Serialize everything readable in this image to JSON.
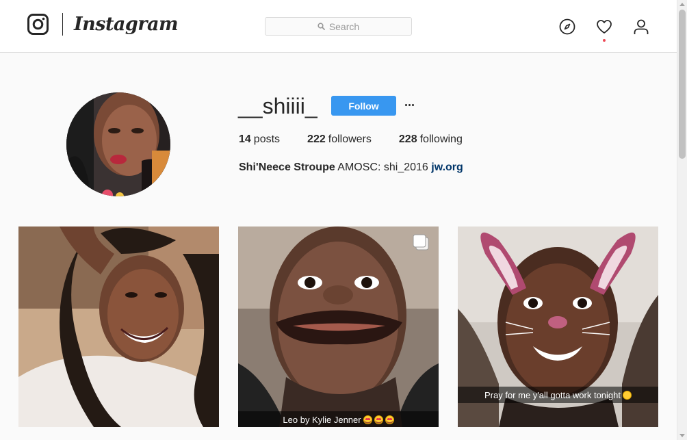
{
  "header": {
    "wordmark": "Instagram",
    "search_placeholder": "Search",
    "nav_icons": [
      "explore-compass-icon",
      "activity-heart-icon",
      "profile-person-icon"
    ],
    "has_activity_notification": true
  },
  "profile": {
    "username": "__shiiii_",
    "follow_label": "Follow",
    "stats": [
      {
        "count": "14",
        "label": "posts"
      },
      {
        "count": "222",
        "label": "followers"
      },
      {
        "count": "228",
        "label": "following"
      }
    ],
    "full_name": "Shi'Neece Stroupe",
    "bio": "AMOSC: shi_2016",
    "link": "jw.org"
  },
  "posts": [
    {
      "caption": "",
      "multiple": false
    },
    {
      "caption": "Leo by Kylie Jenner",
      "emoji_suffix": [
        "heart-eyes-emoji",
        "heart-eyes-emoji",
        "heart-eyes-emoji"
      ],
      "multiple": true
    },
    {
      "caption": "Pray for me y'all gotta work tonight",
      "emoji_suffix": [
        "grimace-emoji"
      ],
      "multiple": false
    }
  ],
  "colors": {
    "accent": "#3897f0",
    "link": "#003569",
    "notification": "#ed4956",
    "background": "#fafafa"
  }
}
